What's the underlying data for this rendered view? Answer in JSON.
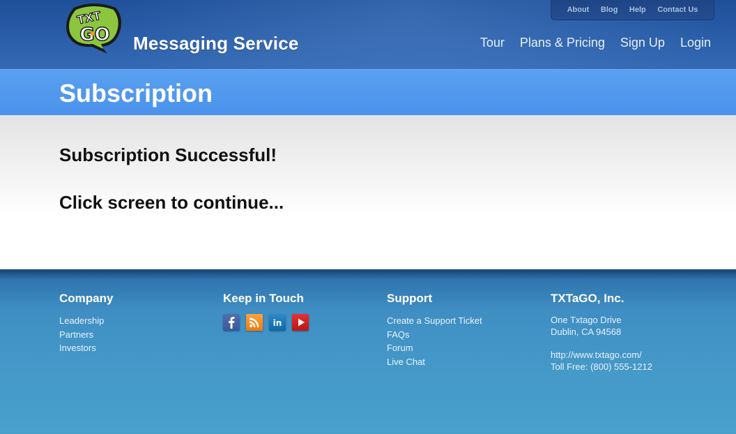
{
  "header": {
    "brand": "Messaging Service",
    "logo_text": "TXT GO",
    "utility_links": [
      "About",
      "Blog",
      "Help",
      "Contact Us"
    ],
    "main_nav": [
      "Tour",
      "Plans & Pricing",
      "Sign Up",
      "Login"
    ]
  },
  "page": {
    "title": "Subscription",
    "message": "Subscription Successful!",
    "prompt": "Click screen to continue..."
  },
  "footer": {
    "company": {
      "heading": "Company",
      "links": [
        "Leadership",
        "Partners",
        "Investors"
      ]
    },
    "keep_in_touch": {
      "heading": "Keep in Touch",
      "icons": [
        "facebook-icon",
        "rss-icon",
        "linkedin-icon",
        "youtube-icon"
      ]
    },
    "support": {
      "heading": "Support",
      "links": [
        "Create a Support Ticket",
        "FAQs",
        "Forum",
        "Live Chat"
      ]
    },
    "contact": {
      "heading": "TXTaGO, Inc.",
      "address_line1": "One Txtago Drive",
      "address_line2": "Dublin, CA 94568",
      "website": "http://www.txtago.com/",
      "phone": "Toll Free: (800) 555-1212"
    }
  },
  "colors": {
    "header": "#2a5ea8",
    "title_band": "#4a92ec",
    "footer": "#4499c8",
    "logo_green": "#8cc63f"
  }
}
